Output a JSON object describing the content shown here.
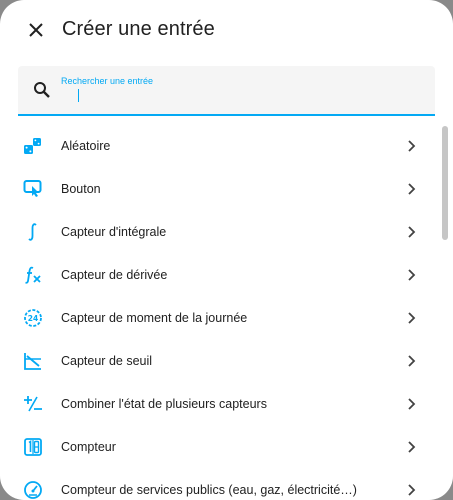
{
  "dialog": {
    "title": "Créer une entrée",
    "close_icon": "close-icon"
  },
  "search": {
    "label": "Rechercher une entrée",
    "value": "",
    "icon": "search-icon"
  },
  "colors": {
    "accent": "#03a9f4",
    "text": "#212121"
  },
  "items": [
    {
      "label": "Aléatoire",
      "icon": "dice-icon"
    },
    {
      "label": "Bouton",
      "icon": "gesture-tap-button-icon"
    },
    {
      "label": "Capteur d'intégrale",
      "icon": "integral-icon"
    },
    {
      "label": "Capteur de dérivée",
      "icon": "function-variant-icon"
    },
    {
      "label": "Capteur de moment de la journée",
      "icon": "clock-24-icon"
    },
    {
      "label": "Capteur de seuil",
      "icon": "threshold-chart-icon"
    },
    {
      "label": "Combiner l'état de plusieurs capteurs",
      "icon": "plus-minus-icon"
    },
    {
      "label": "Compteur",
      "icon": "counter-icon"
    },
    {
      "label": "Compteur de services publics (eau, gaz, électricité…)",
      "icon": "meter-gauge-icon"
    }
  ]
}
